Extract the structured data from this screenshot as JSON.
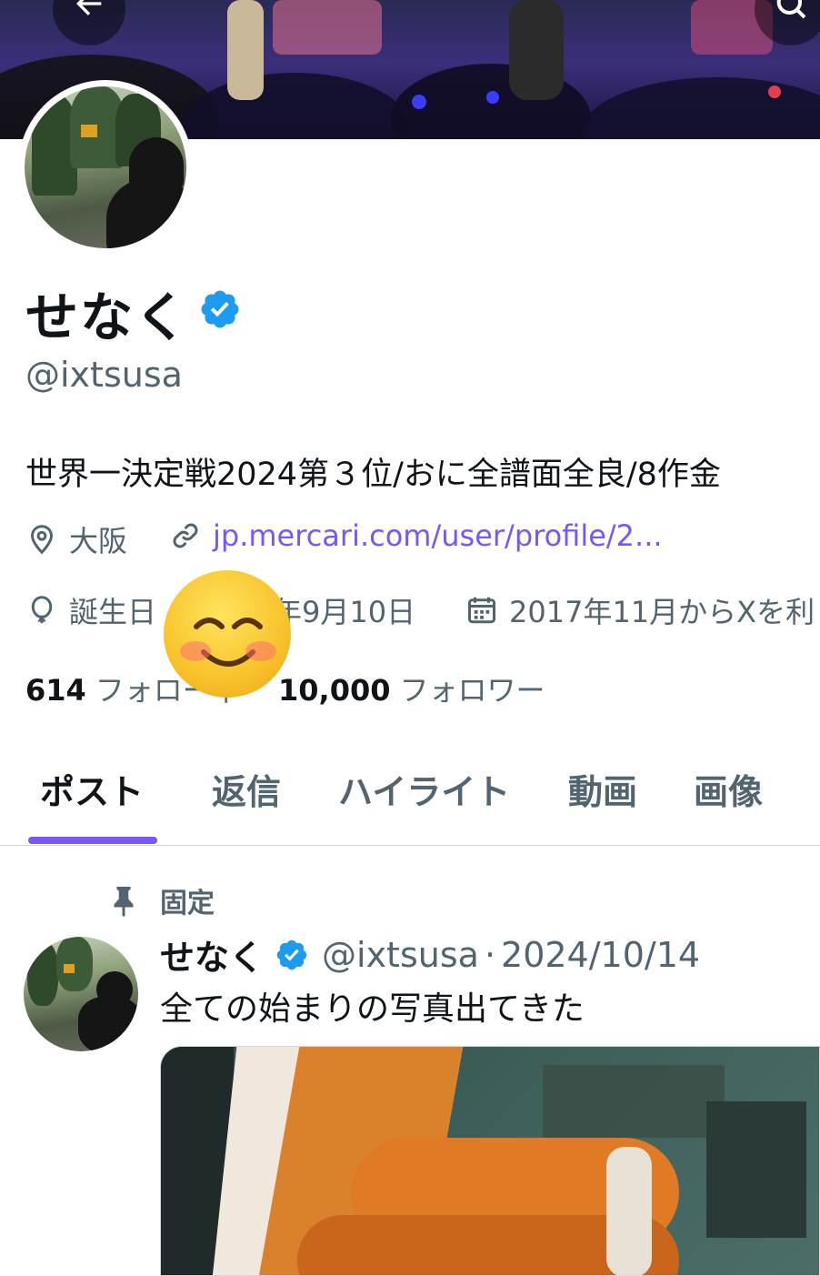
{
  "profile": {
    "name": "せなく",
    "handle": "@ixtsusa",
    "bio": "世界一決定戦2024第３位/おに全譜面全良/8作金",
    "location": "大阪",
    "link": "jp.mercari.com/user/profile/2...",
    "birthday_label": "誕生日",
    "birthday_date": "年9月10日",
    "joined": "2017年11月からXを利",
    "following_count": "614",
    "following_label": "フォロー中",
    "followers_count": "10,000",
    "followers_label": "フォロワー"
  },
  "tabs": [
    {
      "label": "ポスト",
      "active": true
    },
    {
      "label": "返信"
    },
    {
      "label": "ハイライト"
    },
    {
      "label": "動画"
    },
    {
      "label": "画像"
    }
  ],
  "pinned_post": {
    "pinned_label": "固定",
    "author_name": "せなく",
    "author_handle": "@ixtsusa",
    "separator": "·",
    "date": "2024/10/14",
    "text": "全ての始まりの写真出てきた"
  },
  "colors": {
    "accent": "#7856ff",
    "verified": "#1d9bf0",
    "text_primary": "#0f1419",
    "text_secondary": "#536471"
  },
  "icons": {
    "back": "arrow-left-icon",
    "search": "search-icon",
    "verified": "verified-badge-icon",
    "location": "location-pin-icon",
    "link": "link-icon",
    "birthday": "balloon-icon",
    "calendar": "calendar-icon",
    "pin": "pin-icon"
  }
}
